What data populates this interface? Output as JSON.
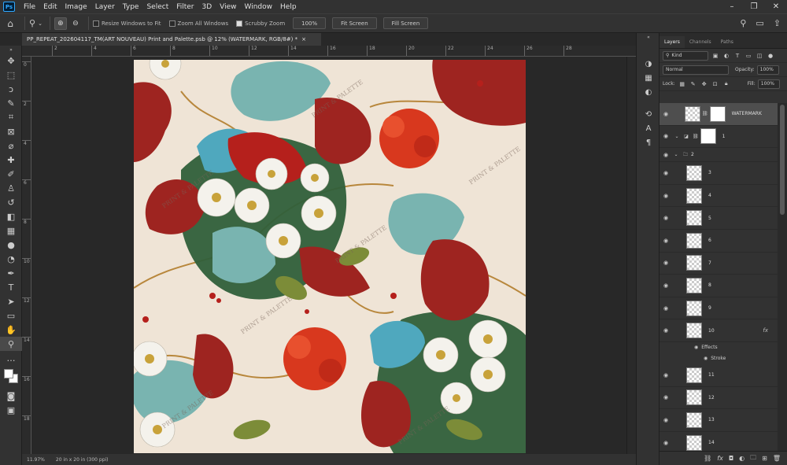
{
  "app": {
    "logo": "Ps"
  },
  "menu": [
    "File",
    "Edit",
    "Image",
    "Layer",
    "Type",
    "Select",
    "Filter",
    "3D",
    "View",
    "Window",
    "Help"
  ],
  "window_controls": [
    "minimize-icon",
    "restore-icon",
    "close-icon"
  ],
  "options_bar": {
    "resize_windows": "Resize Windows to Fit",
    "zoom_all": "Zoom All Windows",
    "scrubby_zoom": "Scrubby Zoom",
    "zoom_value": "100%",
    "fit_screen": "Fit Screen",
    "fill_screen": "Fill Screen",
    "scrubby_checked": true
  },
  "document": {
    "tab_title": "PP_REPEAT_202604117_TM(ART NOUVEAU) Print and Palette.psb @ 12% (WATERMARK, RGB/8#) *",
    "tab_close": "×",
    "zoom": "11.97%",
    "dimensions": "20 in x 20 in (300 ppi)",
    "watermark_text": "PRINT & PALETTE"
  },
  "ruler_top": [
    "2",
    "4",
    "6",
    "8",
    "10",
    "12",
    "14",
    "16",
    "18",
    "20",
    "22",
    "24",
    "26",
    "28"
  ],
  "ruler_left": [
    "0",
    "2",
    "4",
    "6",
    "8",
    "10",
    "12",
    "14",
    "16",
    "18",
    "20"
  ],
  "tools": [
    "move-icon",
    "marquee-icon",
    "lasso-icon",
    "quick-select-icon",
    "crop-icon",
    "frame-icon",
    "eyedropper-icon",
    "healing-icon",
    "brush-icon",
    "stamp-icon",
    "history-brush-icon",
    "eraser-icon",
    "gradient-icon",
    "blur-icon",
    "dodge-icon",
    "pen-icon",
    "type-icon",
    "path-select-icon",
    "shape-icon",
    "hand-icon",
    "zoom-icon",
    "more-icon"
  ],
  "panel": {
    "tabs": [
      "Layers",
      "Channels",
      "Paths"
    ],
    "filter_kind": "Kind",
    "blend_mode": "Normal",
    "opacity_label": "Opacity:",
    "opacity_value": "100%",
    "lock_label": "Lock:",
    "fill_label": "Fill:",
    "fill_value": "100%",
    "layers": [
      {
        "name": "WATERMARK",
        "type": "masked",
        "selected": true
      },
      {
        "name": "1",
        "type": "adjustment"
      },
      {
        "name": "2",
        "type": "group"
      },
      {
        "name": "3",
        "type": "pixel"
      },
      {
        "name": "4",
        "type": "pixel"
      },
      {
        "name": "5",
        "type": "pixel"
      },
      {
        "name": "6",
        "type": "pixel"
      },
      {
        "name": "7",
        "type": "pixel"
      },
      {
        "name": "8",
        "type": "pixel"
      },
      {
        "name": "9",
        "type": "pixel"
      },
      {
        "name": "10",
        "type": "pixel",
        "fx": true
      },
      {
        "name": "11",
        "type": "pixel"
      },
      {
        "name": "12",
        "type": "pixel"
      },
      {
        "name": "13",
        "type": "pixel"
      },
      {
        "name": "14",
        "type": "pixel"
      }
    ],
    "effects_label": "Effects",
    "stroke_label": "Stroke",
    "fx_label": "fx"
  },
  "colors": {
    "fabric": "#efe4d6",
    "red": "#9e2420",
    "orange_red": "#d8381e",
    "teal": "#79b4b0",
    "blue": "#4fa8be",
    "green": "#2f5f3a",
    "olive": "#7c8c38",
    "gold": "#b8873c"
  }
}
